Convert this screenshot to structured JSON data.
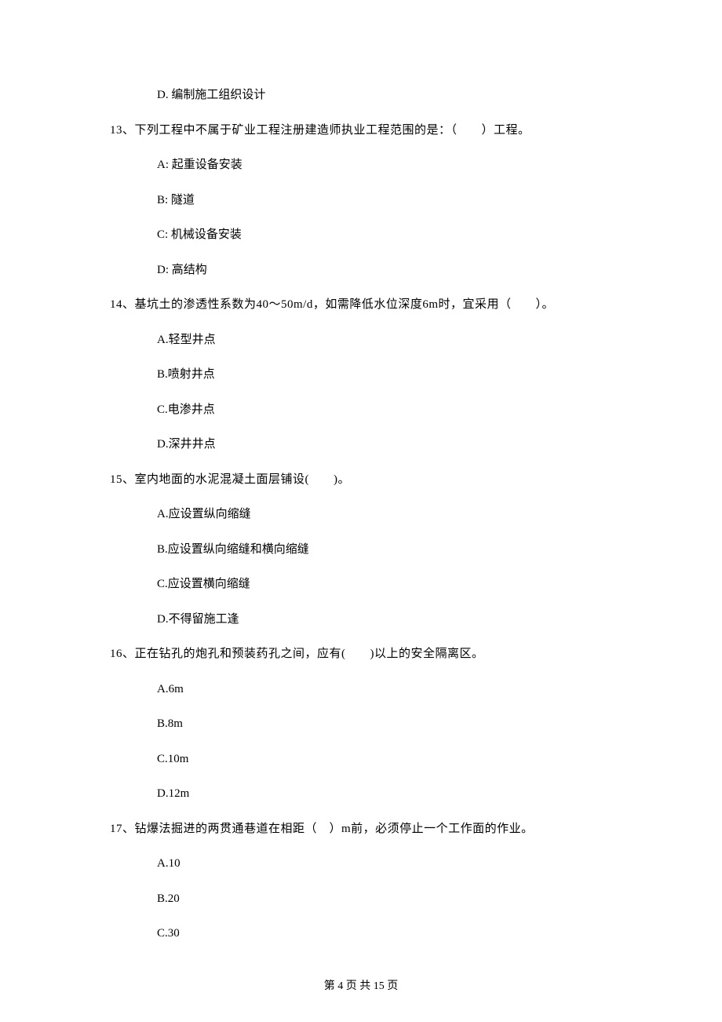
{
  "q12": {
    "options": {
      "D": "D. 编制施工组织设计"
    }
  },
  "q13": {
    "stem": "13、下列工程中不属于矿业工程注册建造师执业工程范围的是：（　　）工程。",
    "options": {
      "A": "A: 起重设备安装",
      "B": "B: 隧道",
      "C": "C: 机械设备安装",
      "D": "D: 高结构"
    }
  },
  "q14": {
    "stem": "14、基坑土的渗透性系数为40～50m/d，如需降低水位深度6m时，宜采用（　　）。",
    "options": {
      "A": "A.轻型井点",
      "B": "B.喷射井点",
      "C": "C.电渗井点",
      "D": "D.深井井点"
    }
  },
  "q15": {
    "stem": "15、室内地面的水泥混凝土面层铺设(　　)。",
    "options": {
      "A": "A.应设置纵向缩缝",
      "B": "B.应设置纵向缩缝和横向缩缝",
      "C": "C.应设置横向缩缝",
      "D": "D.不得留施工逢"
    }
  },
  "q16": {
    "stem": "16、正在钻孔的炮孔和预装药孔之间，应有(　　)以上的安全隔离区。",
    "options": {
      "A": "A.6m",
      "B": "B.8m",
      "C": "C.10m",
      "D": "D.12m"
    }
  },
  "q17": {
    "stem": "17、钻爆法掘进的两贯通巷道在相距（　）m前，必须停止一个工作面的作业。",
    "options": {
      "A": "A.10",
      "B": "B.20",
      "C": "C.30"
    }
  },
  "footer": "第 4 页 共 15 页"
}
